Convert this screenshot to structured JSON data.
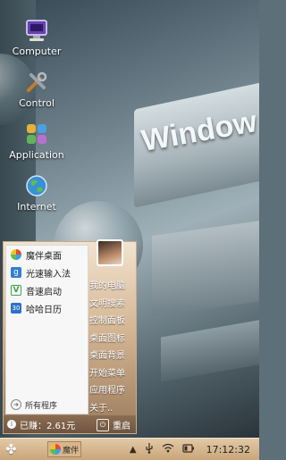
{
  "wallpaper": {
    "logo_text": "Window"
  },
  "desktop_icons": [
    {
      "label": "Computer",
      "icon": "computer-icon"
    },
    {
      "label": "Control",
      "icon": "tools-icon"
    },
    {
      "label": "Application",
      "icon": "app-grid-icon"
    },
    {
      "label": "Internet",
      "icon": "globe-icon"
    }
  ],
  "start_menu": {
    "apps": [
      {
        "label": "魔伴桌面",
        "icon": "pinwheel-icon",
        "color": "#3aa0e8"
      },
      {
        "label": "光速输入法",
        "icon": "g-logo-icon",
        "color": "#2f7fd6"
      },
      {
        "label": "音速启动",
        "icon": "v-logo-icon",
        "color": "#3aa34a"
      },
      {
        "label": "哈哈日历",
        "icon": "calendar-icon",
        "color": "#2b74c9"
      }
    ],
    "all_programs": "所有程序",
    "right_items": [
      "我的电脑",
      "文明搜索",
      "控制面板",
      "桌面图标",
      "桌面背景",
      "开始菜单",
      "应用程序",
      "关于.."
    ],
    "earned": "已赚：2.61元",
    "restart": "重启"
  },
  "taskbar": {
    "task_label": "魔伴",
    "clock": "17:12:32"
  }
}
